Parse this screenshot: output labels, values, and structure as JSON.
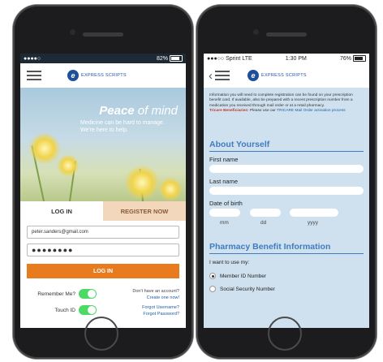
{
  "phone1": {
    "status": {
      "left": "●●●●○",
      "battery": "82%"
    },
    "brand": "EXPRESS SCRIPTS",
    "hero": {
      "title_em": "Peace",
      "title_rest": "of mind",
      "subtitle": "Medicine can be hard to manage. We're here to help."
    },
    "tabs": {
      "login": "LOG IN",
      "register": "REGISTER NOW"
    },
    "form": {
      "email_value": "peter.sanders@gmail.com",
      "password_value": "●●●●●●●●",
      "login_button": "LOG IN",
      "remember_label": "Remember Me?",
      "touchid_label": "Touch ID",
      "no_account": "Don't have an account?",
      "create_link": "Create one now!",
      "forgot_username": "Forgot Username?",
      "forgot_password": "Forgot Password?"
    }
  },
  "phone2": {
    "status": {
      "carrier": "●●●○○ Sprint  LTE",
      "time": "1:30 PM",
      "battery": "76%"
    },
    "brand": "EXPRESS SCRIPTS",
    "intro": "Information you will need to complete registration can be found on your prescription benefit card. If available, also be prepared with a recent prescription number from a medication you received through mail order or at a retail pharmacy.",
    "tricare_label": "Tricare Beneficiaries:",
    "tricare_text": "Please use our",
    "tricare_link": "TRICARE Mail Order activation process",
    "about_heading": "About Yourself",
    "first_name": "First name",
    "last_name": "Last name",
    "dob": "Date of birth",
    "mm": "mm",
    "dd": "dd",
    "yyyy": "yyyy",
    "pharmacy_heading": "Pharmacy Benefit Information",
    "use_my": "I want to use my:",
    "opt1": "Member ID Number",
    "opt2": "Social Security Number",
    "selected_option": "Member ID Number"
  },
  "colors": {
    "brand_blue": "#1e4f9c",
    "accent_orange": "#e87b1e",
    "switch_green": "#4cd964",
    "form_bg": "#cfe1ef"
  }
}
